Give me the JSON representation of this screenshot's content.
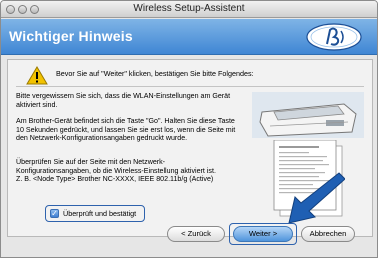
{
  "window": {
    "title": "Wireless Setup-Assistent"
  },
  "header": {
    "title": "Wichtiger Hinweis",
    "logo_icon": "brother-logo-icon"
  },
  "warning": {
    "icon": "warning-icon",
    "text": "Bevor Sie auf \"Weiter\" klicken, bestätigen Sie bitte Folgendes:"
  },
  "paragraphs": {
    "p1": "Bitte vergewissern Sie sich, dass die WLAN-Einstellungen am Gerät aktiviert sind.",
    "p2": "Am Brother-Gerät befindet sich die Taste \"Go\". Halten Sie diese Taste 10 Sekunden gedrückt, und lassen Sie sie erst los, wenn die Seite mit den Netzwerk-Konfigurationsangaben gedruckt wurde.",
    "p3": "Überprüfen Sie auf der Seite mit den Netzwerk-Konfigurationsangaben, ob die Wireless-Einstellung aktiviert ist.\nZ. B. <Node Type> Brother NC-XXXX, IEEE 802.11b/g (Active)"
  },
  "checkbox": {
    "label": "Überprüft und bestätigt",
    "checked": true
  },
  "buttons": {
    "back": "< Zurück",
    "next": "Weiter >",
    "cancel": "Abbrechen"
  },
  "colors": {
    "header_top": "#7fb4e6",
    "header_bottom": "#3f86d4",
    "highlight": "#2e62ad",
    "arrow": "#1f5fb3"
  }
}
